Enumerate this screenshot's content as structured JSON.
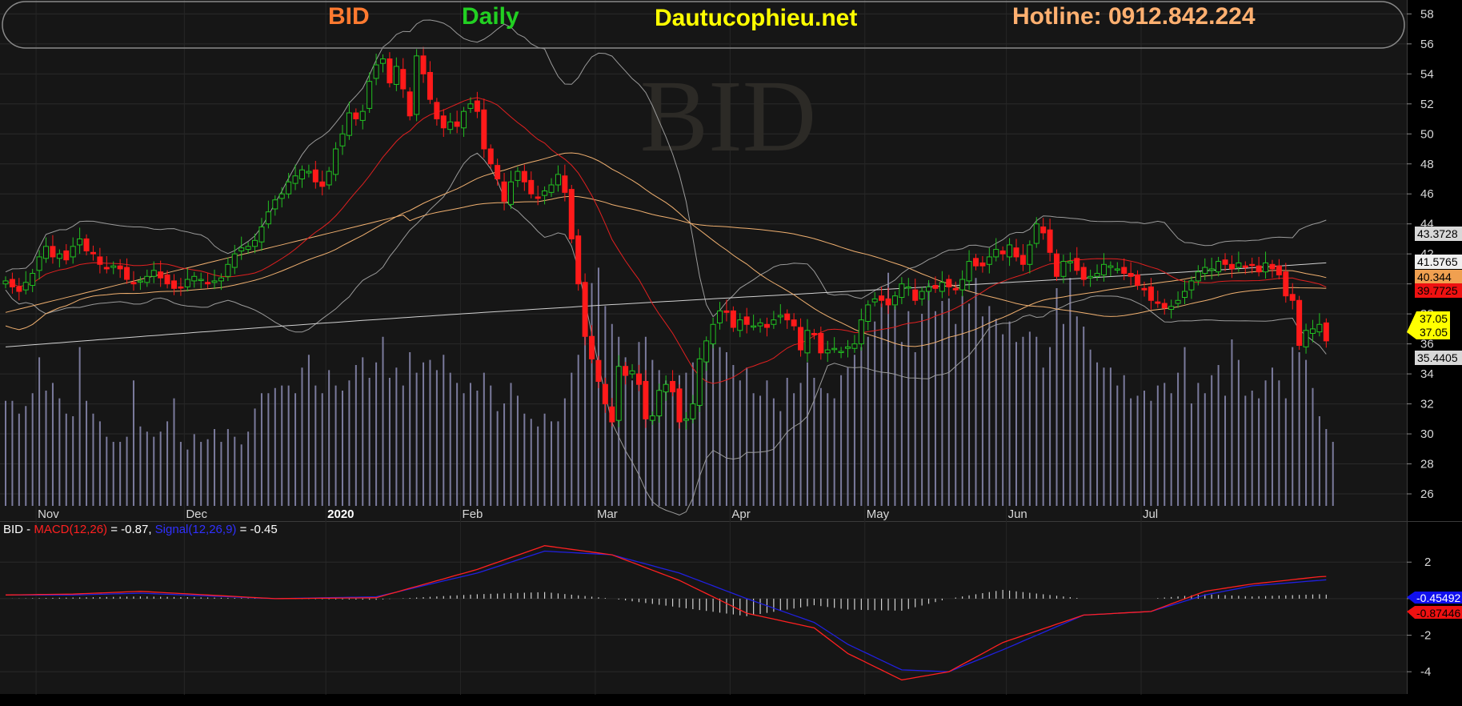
{
  "header": {
    "symbol": "BID",
    "period": "Daily",
    "site": "Dautucophieu.net",
    "hotline": "Hotline: 0912.842.224",
    "watermark": "BID"
  },
  "colors": {
    "background": "#000000",
    "panel": "#161616",
    "up_candle": "#22c022",
    "down_candle": "#ff1a1a",
    "volume": "#7a7a9c",
    "bollinger": "#9a9a9a",
    "ma_short": "#e02020",
    "ma_mid": "#f0b070",
    "ma_long": "#d0d0d0",
    "macd": "#ff2020",
    "signal": "#2020e0",
    "symbol_text": "#ff7a30",
    "period_text": "#22d022",
    "site_text": "#ffff00",
    "hotline_text": "#ffb070"
  },
  "chart_data": [
    {
      "type": "candlestick",
      "title": "BID Daily",
      "x_labels": [
        "Nov",
        "Dec",
        "2020",
        "Feb",
        "Mar",
        "Apr",
        "May",
        "Jun",
        "Jul"
      ],
      "y_ticks": [
        26,
        28,
        30,
        32,
        34,
        36,
        38,
        40,
        42,
        44,
        46,
        48,
        50,
        52,
        54,
        56,
        58
      ],
      "ylim": [
        25.2,
        58.5
      ],
      "last_values": {
        "bb_upper": "43.3728",
        "ma_long": "41.5765",
        "ma_mid": "40.344",
        "ma_short": "39.7725",
        "close_a": "37.05",
        "close_b": "37.05",
        "bb_lower": "35.4405"
      },
      "close": [
        40.2,
        39.8,
        39.5,
        40.1,
        40.7,
        41.8,
        42.5,
        41.8,
        42.0,
        41.6,
        42.5,
        43.0,
        42.2,
        42.0,
        41.3,
        41.0,
        41.2,
        41.0,
        40.3,
        40.0,
        40.2,
        40.5,
        40.9,
        40.4,
        40.0,
        39.7,
        39.8,
        40.3,
        40.5,
        40.3,
        40.0,
        40.2,
        40.4,
        41.3,
        42.0,
        42.4,
        42.5,
        42.9,
        43.8,
        44.8,
        45.6,
        46.0,
        46.8,
        47.2,
        47.6,
        47.5,
        46.8,
        46.5,
        47.5,
        49.0,
        50.0,
        51.4,
        51.0,
        51.5,
        53.5,
        54.6,
        55.0,
        53.4,
        54.5,
        53.0,
        51.2,
        55.2,
        54.0,
        52.3,
        51.0,
        50.4,
        50.8,
        50.5,
        51.5,
        52.0,
        51.5,
        49.0,
        48.0,
        47.0,
        45.5,
        46.8,
        47.5,
        46.8,
        46.0,
        45.7,
        46.2,
        46.6,
        47.3,
        46.1,
        43.0,
        40.0,
        36.5,
        35.0,
        33.5,
        32.0,
        30.8,
        34.5,
        33.9,
        34.2,
        33.3,
        31.0,
        31.2,
        32.9,
        33.3,
        32.8,
        30.8,
        31.0,
        32.0,
        35.0,
        36.2,
        37.3,
        38.2,
        38.1,
        37.1,
        37.6,
        37.3,
        37.2,
        37.4,
        37.1,
        37.6,
        37.9,
        37.6,
        37.2,
        35.6,
        36.9,
        36.6,
        35.4,
        35.6,
        35.7,
        35.5,
        35.8,
        36.0,
        37.6,
        38.6,
        39.0,
        38.9,
        38.6,
        39.2,
        40.0,
        39.8,
        38.9,
        39.5,
        39.8,
        39.7,
        40.1,
        39.8,
        39.6,
        40.3,
        41.5,
        41.2,
        41.2,
        41.8,
        42.3,
        42.0,
        42.6,
        41.8,
        41.3,
        42.6,
        44.0,
        43.4,
        42.1,
        40.5,
        41.5,
        41.5,
        40.9,
        40.3,
        40.5,
        40.7,
        41.3,
        41.2,
        41.0,
        40.7,
        40.5,
        39.9,
        39.6,
        38.9,
        38.7,
        38.4,
        38.5,
        38.9,
        39.5,
        40.2,
        40.8,
        41.1,
        41.0,
        41.5,
        41.3,
        41.0,
        41.4,
        41.1,
        41.3,
        40.8,
        41.4,
        41.0,
        40.6,
        39.2,
        38.9,
        35.9,
        36.9,
        37.0,
        37.3,
        36.2
      ],
      "volume_relative": [
        0.41,
        0.41,
        0.36,
        0.39,
        0.44,
        0.58,
        0.45,
        0.48,
        0.42,
        0.36,
        0.35,
        0.62,
        0.41,
        0.36,
        0.33,
        0.27,
        0.25,
        0.25,
        0.27,
        0.49,
        0.31,
        0.29,
        0.27,
        0.29,
        0.33,
        0.42,
        0.25,
        0.22,
        0.28,
        0.25,
        0.26,
        0.3,
        0.25,
        0.3,
        0.27,
        0.24,
        0.29,
        0.38,
        0.44,
        0.44,
        0.46,
        0.47,
        0.47,
        0.44,
        0.54,
        0.59,
        0.47,
        0.44,
        0.53,
        0.47,
        0.45,
        0.49,
        0.55,
        0.58,
        0.5,
        0.56,
        0.66,
        0.5,
        0.54,
        0.47,
        0.6,
        0.52,
        0.56,
        0.57,
        0.53,
        0.59,
        0.52,
        0.48,
        0.44,
        0.48,
        0.45,
        0.52,
        0.47,
        0.37,
        0.4,
        0.48,
        0.43,
        0.36,
        0.34,
        0.31,
        0.36,
        0.33,
        0.33,
        0.42,
        0.52,
        0.59,
        0.77,
        0.87,
        0.93,
        0.78,
        0.71,
        0.66,
        0.58,
        0.49,
        0.64,
        0.66,
        0.57,
        0.53,
        0.49,
        0.46,
        0.51,
        0.52,
        0.56,
        0.55,
        0.64,
        0.64,
        0.62,
        0.6,
        0.55,
        0.49,
        0.54,
        0.44,
        0.43,
        0.49,
        0.42,
        0.37,
        0.5,
        0.44,
        0.48,
        0.56,
        0.5,
        0.46,
        0.44,
        0.42,
        0.51,
        0.54,
        0.59,
        0.62,
        0.66,
        0.72,
        0.79,
        0.91,
        0.78,
        0.64,
        0.76,
        0.6,
        0.75,
        0.87,
        0.76,
        0.8,
        0.81,
        0.71,
        0.82,
        0.79,
        0.89,
        0.74,
        0.78,
        0.73,
        0.67,
        0.72,
        0.64,
        0.66,
        0.68,
        0.66,
        0.54,
        0.62,
        0.85,
        0.71,
        0.89,
        0.74,
        0.7,
        0.61,
        0.56,
        0.54,
        0.54,
        0.47,
        0.51,
        0.42,
        0.43,
        0.45,
        0.41,
        0.47,
        0.48,
        0.44,
        0.52,
        0.62,
        0.4,
        0.48,
        0.44,
        0.51,
        0.55,
        0.43,
        0.65,
        0.57,
        0.43,
        0.45,
        0.42,
        0.49,
        0.54,
        0.49,
        0.42,
        0.62,
        0.6,
        0.57,
        0.46,
        0.35,
        0.3,
        0.25
      ]
    },
    {
      "type": "line",
      "label": "BID - MACD(12,26) = -0.87, Signal(12,26,9) = -0.45",
      "legend": {
        "prefix": "BID - ",
        "macd_name": "MACD(12,26)",
        "macd_value": " = -0.87, ",
        "signal_name": "Signal(12,26,9)",
        "signal_value": " = -0.45"
      },
      "y_ticks": [
        -4,
        -2,
        0,
        2
      ],
      "ylim": [
        -5,
        3.5
      ],
      "last_values": {
        "signal": "-0.45492",
        "macd": "-0.87446"
      },
      "series": [
        {
          "name": "MACD(12,26)",
          "points": [
            [
              0,
              0.2
            ],
            [
              10,
              0.25
            ],
            [
              20,
              0.4
            ],
            [
              30,
              0.2
            ],
            [
              40,
              0.0
            ],
            [
              55,
              0.05
            ],
            [
              70,
              1.6
            ],
            [
              80,
              2.9
            ],
            [
              90,
              2.4
            ],
            [
              100,
              1.0
            ],
            [
              110,
              -0.8
            ],
            [
              120,
              -1.6
            ],
            [
              125,
              -3.0
            ],
            [
              133,
              -4.45
            ],
            [
              140,
              -4.0
            ],
            [
              148,
              -2.4
            ],
            [
              160,
              -0.9
            ],
            [
              170,
              -0.7
            ],
            [
              178,
              0.4
            ],
            [
              185,
              0.8
            ],
            [
              195,
              1.2
            ],
            [
              201,
              1.3
            ],
            [
              210,
              0.5
            ],
            [
              218,
              -0.4
            ],
            [
              230,
              0.2
            ],
            [
              240,
              -0.2
            ],
            [
              247,
              -0.87
            ]
          ]
        },
        {
          "name": "Signal(12,26,9)",
          "points": [
            [
              0,
              0.2
            ],
            [
              10,
              0.2
            ],
            [
              20,
              0.3
            ],
            [
              30,
              0.15
            ],
            [
              40,
              0.0
            ],
            [
              55,
              0.1
            ],
            [
              70,
              1.4
            ],
            [
              80,
              2.6
            ],
            [
              90,
              2.4
            ],
            [
              100,
              1.4
            ],
            [
              110,
              0.0
            ],
            [
              120,
              -1.3
            ],
            [
              125,
              -2.5
            ],
            [
              133,
              -3.9
            ],
            [
              140,
              -4.0
            ],
            [
              148,
              -2.8
            ],
            [
              160,
              -0.9
            ],
            [
              170,
              -0.7
            ],
            [
              178,
              0.2
            ],
            [
              185,
              0.7
            ],
            [
              195,
              1.0
            ],
            [
              201,
              1.2
            ],
            [
              210,
              0.7
            ],
            [
              218,
              -0.1
            ],
            [
              230,
              0.2
            ],
            [
              240,
              0.0
            ],
            [
              247,
              -0.45
            ]
          ]
        }
      ]
    }
  ]
}
